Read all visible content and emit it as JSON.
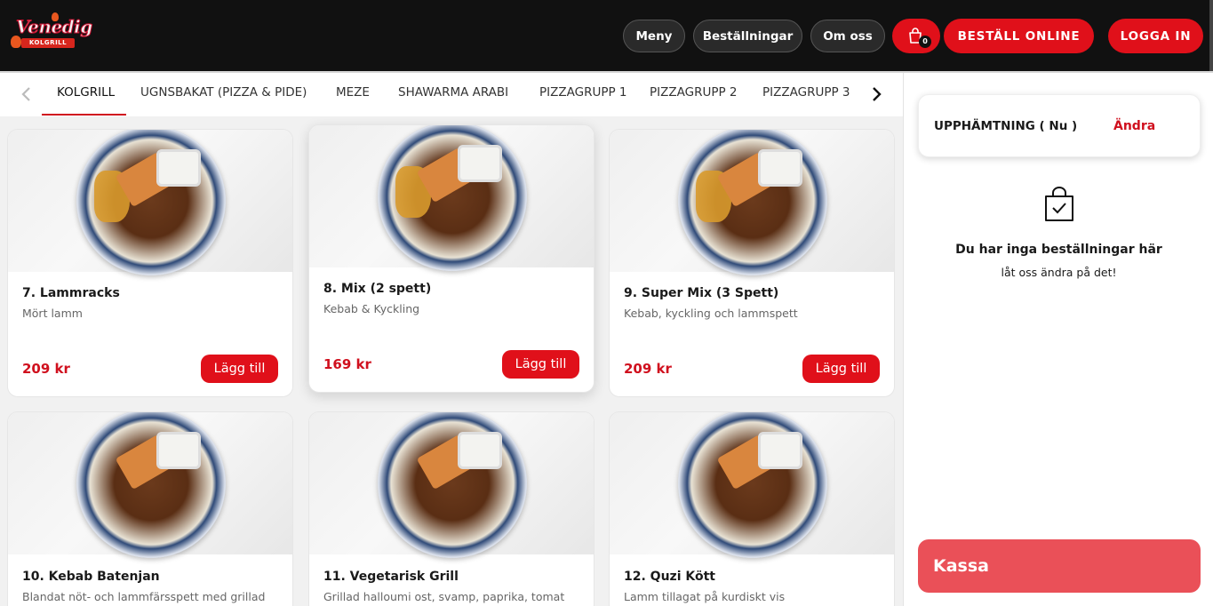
{
  "header": {
    "logo_text": "Venedig",
    "logo_sub": "KOLGRILL",
    "nav_menu": "Meny",
    "nav_orders": "Beställningar",
    "nav_about": "Om oss",
    "cart_count": "0",
    "order_online": "BESTÄLL ONLINE",
    "login": "LOGGA IN"
  },
  "categories": {
    "prev_icon": "chevron-left-icon",
    "next_icon": "chevron-right-icon",
    "tabs": [
      "KOLGRILL",
      "UGNSBAKAT (PIZZA & PIDE)",
      "MEZE",
      "SHAWARMA ARABI",
      "PIZZAGRUPP 1",
      "PIZZAGRUPP 2",
      "PIZZAGRUPP 3"
    ],
    "active": "KOLGRILL"
  },
  "products": [
    {
      "title": "7. Lammracks",
      "desc": "Mört lamm",
      "price": "209 kr",
      "button": "Lägg till"
    },
    {
      "title": "8. Mix (2 spett)",
      "desc": "Kebab & Kyckling",
      "price": "169 kr",
      "button": "Lägg till"
    },
    {
      "title": "9. Super Mix (3 Spett)",
      "desc": "Kebab, kyckling och lammspett",
      "price": "209 kr",
      "button": "Lägg till"
    },
    {
      "title": "10. Kebab Batenjan",
      "desc": "Blandat nöt- och lammfärsspett med grillad",
      "price": "",
      "button": ""
    },
    {
      "title": "11. Vegetarisk Grill",
      "desc": "Grillad halloumi ost, svamp, paprika, tomat",
      "price": "",
      "button": ""
    },
    {
      "title": "12. Quzi Kött",
      "desc": "Lamm tillagat på kurdiskt vis",
      "price": "",
      "button": ""
    }
  ],
  "sidebar": {
    "pickup_label": "UPPHÄMTNING ( Nu )",
    "pickup_change": "Ändra",
    "bag_icon": "shopping-bag-check-icon",
    "empty_title": "Du har inga beställningar här",
    "empty_sub": "låt oss ändra på det!",
    "checkout": "Kassa"
  },
  "colors": {
    "accent": "#e0101a",
    "header_bg": "#111111",
    "checkout_bg": "#ea5058",
    "price": "#d0101e"
  }
}
